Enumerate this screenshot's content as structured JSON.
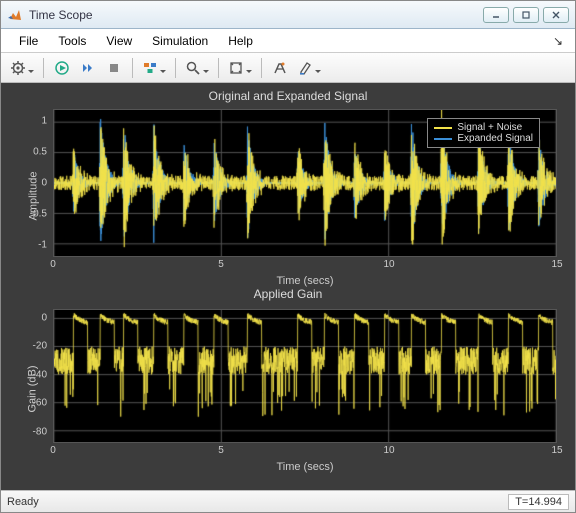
{
  "window": {
    "title": "Time Scope"
  },
  "menu": {
    "file": "File",
    "tools": "Tools",
    "view": "View",
    "simulation": "Simulation",
    "help": "Help"
  },
  "status": {
    "ready": "Ready",
    "time": "T=14.994"
  },
  "chart1": {
    "title": "Original and Expanded Signal",
    "ylabel": "Amplitude",
    "xlabel": "Time (secs)",
    "yticks": [
      -1,
      -0.5,
      0,
      0.5,
      1
    ],
    "xticks": [
      0,
      5,
      10,
      15
    ],
    "ylim": [
      -1.2,
      1.2
    ],
    "xlim": [
      0,
      15
    ],
    "legend": {
      "s1": "Signal + Noise",
      "s2": "Expanded Signal"
    },
    "colors": {
      "s1": "#f2e24a",
      "s2": "#3b8fd8"
    }
  },
  "chart2": {
    "title": "Applied Gain",
    "ylabel": "Gain (dB)",
    "xlabel": "Time (secs)",
    "yticks": [
      -80,
      -60,
      -40,
      -20,
      0
    ],
    "xticks": [
      0,
      5,
      10,
      15
    ],
    "ylim": [
      -88,
      6
    ],
    "xlim": [
      0,
      15
    ],
    "colors": {
      "s1": "#f2e24a"
    }
  },
  "chart_data": [
    {
      "type": "line",
      "title": "Original and Expanded Signal",
      "xlabel": "Time (secs)",
      "ylabel": "Amplitude",
      "xlim": [
        0,
        15
      ],
      "ylim": [
        -1.2,
        1.2
      ],
      "burst_centers": [
        0.6,
        1.4,
        2.1,
        3.0,
        3.9,
        4.8,
        5.8,
        7.3,
        8.1,
        9.0,
        9.9,
        10.7,
        11.6,
        12.7,
        13.6,
        14.5
      ],
      "burst_amp1": [
        0.55,
        1.05,
        0.95,
        0.95,
        0.65,
        0.7,
        0.9,
        0.6,
        1.0,
        0.65,
        0.6,
        1.05,
        1.05,
        0.8,
        0.85,
        0.75
      ],
      "burst_amp2": [
        0.5,
        1.0,
        0.9,
        0.9,
        0.6,
        0.65,
        0.85,
        0.55,
        0.95,
        0.6,
        0.55,
        1.0,
        1.0,
        0.75,
        0.8,
        0.7
      ],
      "noise_floor": 0.12,
      "series_colors": {
        "Signal + Noise": "#f2e24a",
        "Expanded Signal": "#3b8fd8"
      },
      "legend": [
        "Signal + Noise",
        "Expanded Signal"
      ]
    },
    {
      "type": "line",
      "title": "Applied Gain",
      "xlabel": "Time (secs)",
      "ylabel": "Gain (dB)",
      "xlim": [
        0,
        15
      ],
      "ylim": [
        -88,
        6
      ],
      "gain_peak": 2,
      "gain_floor_mean": -30,
      "gain_floor_spikes": -70,
      "burst_centers": [
        0.6,
        1.4,
        2.1,
        3.0,
        3.9,
        4.8,
        5.8,
        7.3,
        8.1,
        9.0,
        9.9,
        10.7,
        11.6,
        12.7,
        13.6,
        14.5
      ],
      "series_colors": {
        "Gain": "#f2e24a"
      }
    }
  ]
}
